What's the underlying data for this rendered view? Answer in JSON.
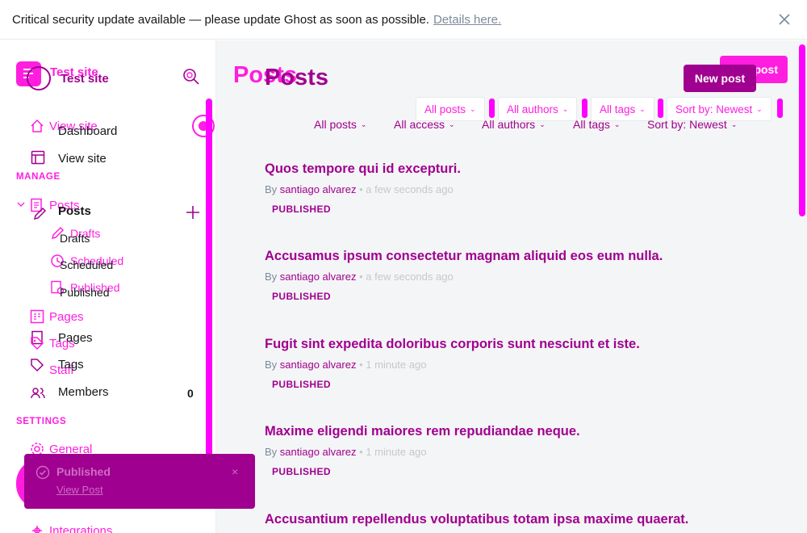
{
  "banner": {
    "text": "Critical security update available — please update Ghost as soon as possible.",
    "link": "Details here."
  },
  "sidebar": {
    "site_title_ghost": "Test site",
    "site_title": "Test site",
    "nav_ghost": {
      "view_site": "View site",
      "posts": "Posts",
      "drafts": "Drafts",
      "scheduled": "Scheduled",
      "published": "Published",
      "pages": "Pages",
      "tags": "Tags",
      "staff": "Staff",
      "general": "General",
      "integrations": "Integrations"
    },
    "nav": {
      "dashboard": "Dashboard",
      "view_site": "View site",
      "posts": "Posts",
      "drafts": "Drafts",
      "scheduled": "Scheduled",
      "published": "Published",
      "pages": "Pages",
      "tags": "Tags",
      "members": "Members",
      "members_count": "0"
    },
    "sections": {
      "manage": "MANAGE",
      "settings": "SETTINGS"
    }
  },
  "main": {
    "title_ghost": "Posts",
    "title": "Posts",
    "new_post_ghost": "post",
    "new_post": "New post",
    "filters_ghost": [
      "All posts",
      "All authors",
      "All tags",
      "Sort by: Newest"
    ],
    "filters": [
      "All posts",
      "All access",
      "All authors",
      "All tags",
      "Sort by: Newest"
    ],
    "posts": [
      {
        "title": "Quos tempore qui id excepturi.",
        "by": "By",
        "author": "santiago alvarez",
        "time": "a few seconds ago",
        "status": "PUBLISHED"
      },
      {
        "title": "Accusamus ipsum consectetur magnam aliquid eos eum nulla.",
        "by": "By",
        "author": "santiago alvarez",
        "time": "a few seconds ago",
        "status": "PUBLISHED"
      },
      {
        "title": "Fugit sint expedita doloribus corporis sunt nesciunt et iste.",
        "by": "By",
        "author": "santiago alvarez",
        "time": "1 minute ago",
        "status": "PUBLISHED"
      },
      {
        "title": "Maxime eligendi maiores rem repudiandae neque.",
        "by": "By",
        "author": "santiago alvarez",
        "time": "1 minute ago",
        "status": "PUBLISHED"
      },
      {
        "title": "Accusantium repellendus voluptatibus totam ipsa maxime quaerat.",
        "by": "",
        "author": "",
        "time": "",
        "status": ""
      }
    ]
  },
  "toast": {
    "message": "Published",
    "action": "View Post",
    "close": "×"
  },
  "colors": {
    "accent_ghost": "#ff1ee0",
    "accent": "#a0008f",
    "scrollbar": "#ff00ff"
  }
}
